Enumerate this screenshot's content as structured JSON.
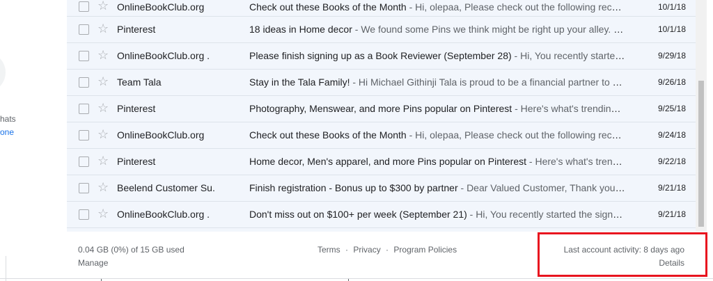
{
  "sidebar": {
    "partial_text": "hats",
    "partial_link": "one"
  },
  "emails": [
    {
      "sender": "OnlineBookClub.org",
      "subject": "Check out these Books of the Month",
      "snippet": " - Hi, olepaa, Please check out the following recent…",
      "date": "10/1/18"
    },
    {
      "sender": "Pinterest",
      "subject": "18 ideas in Home decor",
      "snippet": " - We found some Pins we think might be right up your alley. Ne…",
      "date": "10/1/18"
    },
    {
      "sender": "OnlineBookClub.org .",
      "subject": "Please finish signing up as a Book Reviewer (September 28)",
      "snippet": " - Hi, You recently started t…",
      "date": "9/29/18"
    },
    {
      "sender": "Team Tala",
      "subject": "Stay in the Tala Family!",
      "snippet": " - Hi Michael Githinji Tala is proud to be a financial partner to hu…",
      "date": "9/26/18"
    },
    {
      "sender": "Pinterest",
      "subject": "Photography, Menswear, and more Pins popular on Pinterest",
      "snippet": " - Here's what's trending on…",
      "date": "9/25/18"
    },
    {
      "sender": "OnlineBookClub.org",
      "subject": "Check out these Books of the Month",
      "snippet": " - Hi, olepaa, Please check out the following recent…",
      "date": "9/24/18"
    },
    {
      "sender": "Pinterest",
      "subject": "Home decor, Men's apparel, and more Pins popular on Pinterest",
      "snippet": " - Here's what's trending…",
      "date": "9/22/18"
    },
    {
      "sender": "Beelend Customer Su.",
      "subject": "Finish registration - Bonus up to $300 by partner",
      "snippet": " - Dear Valued Customer, Thank you for…",
      "date": "9/21/18"
    },
    {
      "sender": "OnlineBookClub.org .",
      "subject": "Don't miss out on $100+ per week (September 21)",
      "snippet": " - Hi, You recently started the sign up…",
      "date": "9/21/18"
    }
  ],
  "footer": {
    "storage": "0.04 GB (0%) of 15 GB used",
    "manage": "Manage",
    "links": [
      "Terms",
      "Privacy",
      "Program Policies"
    ],
    "separator": "·",
    "activity": "Last account activity: 8 days ago",
    "details": "Details"
  },
  "icons": {
    "checkbox": "checkbox-icon",
    "star": "star-icon"
  },
  "colors": {
    "highlight": "#e8141f",
    "list_bg": "#f2f6fc"
  }
}
